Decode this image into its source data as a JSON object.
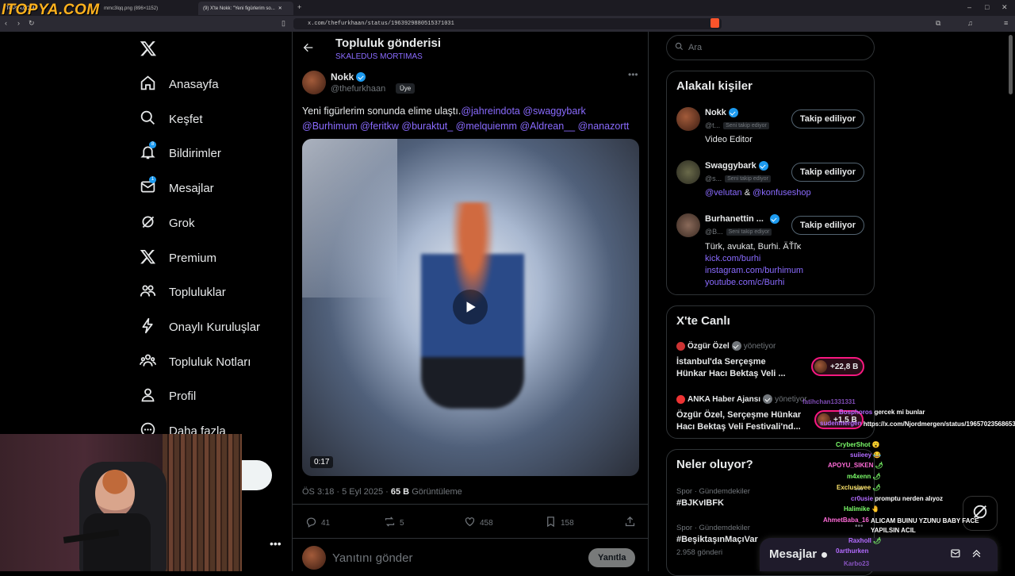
{
  "browser": {
    "tabs": [
      {
        "label": "ITOPYA.COM"
      },
      {
        "label": "mmc3lqq.png (896×1152)"
      },
      {
        "label": "(9) X'te Nokk: \"Yeni figürlerim so..."
      }
    ],
    "url": "x.com/thefurkhaan/status/1963929880515371031"
  },
  "watermark": "ITOPYA.COM",
  "nav": {
    "items": [
      {
        "label": "Anasayfa",
        "icon": "home-icon"
      },
      {
        "label": "Keşfet",
        "icon": "search-icon"
      },
      {
        "label": "Bildirimler",
        "icon": "bell-icon",
        "badge": "8"
      },
      {
        "label": "Mesajlar",
        "icon": "mail-icon",
        "badge": "1"
      },
      {
        "label": "Grok",
        "icon": "grok-icon"
      },
      {
        "label": "Premium",
        "icon": "x-icon"
      },
      {
        "label": "Topluluklar",
        "icon": "people-icon"
      },
      {
        "label": "Onaylı Kuruluşlar",
        "icon": "lightning-icon"
      },
      {
        "label": "Topluluk Notları",
        "icon": "notes-icon"
      },
      {
        "label": "Profil",
        "icon": "person-icon"
      },
      {
        "label": "Daha fazla",
        "icon": "more-icon"
      }
    ]
  },
  "header": {
    "title": "Topluluk gönderisi",
    "community": "SKALEDUS MORTIMAS"
  },
  "post": {
    "author_name": "Nokk",
    "author_handle": "@thefurkhaan",
    "member_label": "Üye",
    "text_plain": "Yeni figürlerim sonunda elime ulaştı.",
    "mentions_line1": "@jahreindota @swaggybark",
    "mentions_line2": "@Burhimum @feritkw @buraktut_ @melquiemm @Aldrean__ @nanazortt",
    "video_duration": "0:17",
    "timestamp": "ÖS 3:18 · 5 Eyl 2025 · ",
    "views_count": "65 B",
    "views_label": " Görüntüleme",
    "stats": {
      "replies": "41",
      "reposts": "5",
      "likes": "458",
      "bookmarks": "158"
    },
    "reply_placeholder": "Yanıtını gönder",
    "reply_button": "Yanıtla"
  },
  "search": {
    "placeholder": "Ara"
  },
  "related": {
    "title": "Alakalı kişiler",
    "people": [
      {
        "name": "Nokk",
        "handle": "@t...",
        "pill": "Seni takip ediyor",
        "button": "Takip ediliyor",
        "bio": "Video Editor"
      },
      {
        "name": "Swaggybark",
        "handle": "@s...",
        "pill": "Seni takip ediyor",
        "button": "Takip ediliyor",
        "bio_link1": "@velutan",
        "bio_and": " & ",
        "bio_link2": "@konfuseshop"
      },
      {
        "name": "Burhanettin ...",
        "handle": "@B...",
        "pill": "Seni takip ediyor",
        "button": "Takip ediliyor",
        "bio": "Türk, avukat, Burhi. ÄŤľĸ",
        "links": [
          "kick.com/burhi",
          "instagram.com/burhimum",
          "youtube.com/c/Burhi"
        ]
      }
    ]
  },
  "live": {
    "title": "X'te Canlı",
    "items": [
      {
        "host": "Özgür Özel",
        "role": "yönetiyor",
        "title": "İstanbul'da Serçeşme Hünkar Hacı Bektaş Veli ...",
        "count": "+22,8 B"
      },
      {
        "host": "ANKA Haber Ajansı",
        "role": "yönetiyor",
        "title": "Özgür Özel, Serçeşme Hünkar Hacı Bektaş Veli Festivali'nd...",
        "count": "+1,5 B"
      }
    ]
  },
  "trends": {
    "title": "Neler oluyor?",
    "items": [
      {
        "category": "Spor · Gündemdekiler",
        "name": "#BJKvIBFK",
        "posts": ""
      },
      {
        "category": "Spor · Gündemdekiler",
        "name": "#BeşiktaşınMaçıVar",
        "posts": "2.958 gönderi"
      }
    ]
  },
  "messages_bar": {
    "label": "Mesajlar"
  },
  "chat": [
    {
      "user": "fatihchan1331331",
      "msg": "",
      "color": "#b36bff"
    },
    {
      "user": "Bosphoros",
      "msg": "gercek mi bunlar",
      "color": "#b36bff"
    },
    {
      "user": "sudenmergen",
      "msg": "https://x.com/Njordmergen/status/1965702356865310754",
      "color": "#b36bff"
    },
    {
      "user": "CryberShot",
      "msg": "😮",
      "color": "#7dff6b"
    },
    {
      "user": "suiieey",
      "msg": "😂",
      "color": "#b36bff"
    },
    {
      "user": "APOYU_SIKEN",
      "msg": "🌶",
      "color": "#ff6bd8"
    },
    {
      "user": "m4xenn",
      "msg": "🌶",
      "color": "#7dff6b"
    },
    {
      "user": "Exclusiwee",
      "msg": "🌶",
      "color": "#ffe66b"
    },
    {
      "user": "cr0usie",
      "msg": "promptu nerden alıyoz",
      "color": "#b36bff"
    },
    {
      "user": "Halimike",
      "msg": "🤚",
      "color": "#7dff6b"
    },
    {
      "user": "AhmetBaba_16",
      "msg": "ALICAM BUINU YZUNU BABY FACE YAPILSIN ACIL",
      "color": "#ff6bd8"
    },
    {
      "user": "Raxholl",
      "msg": "🌶",
      "color": "#b36bff"
    },
    {
      "user": "0arthurken",
      "msg": "",
      "color": "#b36bff"
    },
    {
      "user": "Karbo23",
      "msg": "",
      "color": "#b36bff"
    }
  ]
}
